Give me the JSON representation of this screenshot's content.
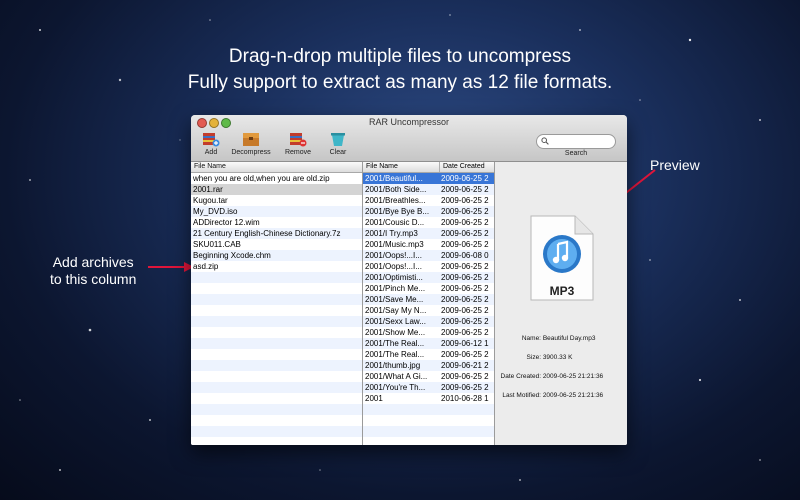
{
  "headline": {
    "line1": "Drag-n-drop multiple files to uncompress",
    "line2": "Fully support to extract as many as 12 file formats."
  },
  "annotations": {
    "preview": "Preview",
    "add_line1": "Add archives",
    "add_line2": "to this column"
  },
  "colors": {
    "arrow": "#e0153a",
    "selection": "#3875d7"
  },
  "window": {
    "title": "RAR Uncompressor",
    "toolbar": [
      {
        "label": "Add",
        "icon": "add-archive-icon"
      },
      {
        "label": "Decompress",
        "icon": "decompress-icon"
      },
      {
        "label": "Remove",
        "icon": "remove-archive-icon"
      },
      {
        "label": "Clear",
        "icon": "clear-icon"
      }
    ],
    "search_label": "Search",
    "search_placeholder": ""
  },
  "archives": {
    "header": "File Name",
    "rows": [
      "when you are old,when you are old.zip",
      "2001.rar",
      "Kugou.tar",
      "My_DVD.iso",
      "ADDirector 12.wim",
      "21 Century English-Chinese Dictionary.7z",
      "SKU011.CAB",
      "Beginning Xcode.chm",
      "asd.zip"
    ],
    "selected_index": 1
  },
  "contents": {
    "headers": [
      "File Name",
      "Date Created"
    ],
    "rows": [
      [
        "2001/Beautiful...",
        "2009-06-25 2"
      ],
      [
        "2001/Both Side...",
        "2009-06-25 2"
      ],
      [
        "2001/Breathles...",
        "2009-06-25 2"
      ],
      [
        "2001/Bye Bye B...",
        "2009-06-25 2"
      ],
      [
        "2001/Cousic D...",
        "2009-06-25 2"
      ],
      [
        "2001/I Try.mp3",
        "2009-06-25 2"
      ],
      [
        "2001/Music.mp3",
        "2009-06-25 2"
      ],
      [
        "2001/Oops!...I...",
        "2009-06-08 0"
      ],
      [
        "2001/Oops!...I...",
        "2009-06-25 2"
      ],
      [
        "2001/Optimisti...",
        "2009-06-25 2"
      ],
      [
        "2001/Pinch Me...",
        "2009-06-25 2"
      ],
      [
        "2001/Save Me...",
        "2009-06-25 2"
      ],
      [
        "2001/Say My N...",
        "2009-06-25 2"
      ],
      [
        "2001/Sexx Law...",
        "2009-06-25 2"
      ],
      [
        "2001/Show Me...",
        "2009-06-25 2"
      ],
      [
        "2001/The Real...",
        "2009-06-12 1"
      ],
      [
        "2001/The Real...",
        "2009-06-25 2"
      ],
      [
        "2001/thumb.jpg",
        "2009-06-21 2"
      ],
      [
        "2001/What A Gi...",
        "2009-06-25 2"
      ],
      [
        "2001/You're Th...",
        "2009-06-25 2"
      ],
      [
        "2001",
        "2010-06-28 1"
      ]
    ],
    "selected_index": 0
  },
  "preview": {
    "icon_label": "MP3",
    "icon": "mp3-file-icon",
    "fields": [
      {
        "label": "Name:",
        "value": "Beautiful Day.mp3"
      },
      {
        "label": "Size:",
        "value": "3900.33 K"
      },
      {
        "label": "Date Created:",
        "value": "2009-06-25 21:21:36"
      },
      {
        "label": "Last Motified:",
        "value": "2009-06-25 21:21:36"
      }
    ]
  }
}
